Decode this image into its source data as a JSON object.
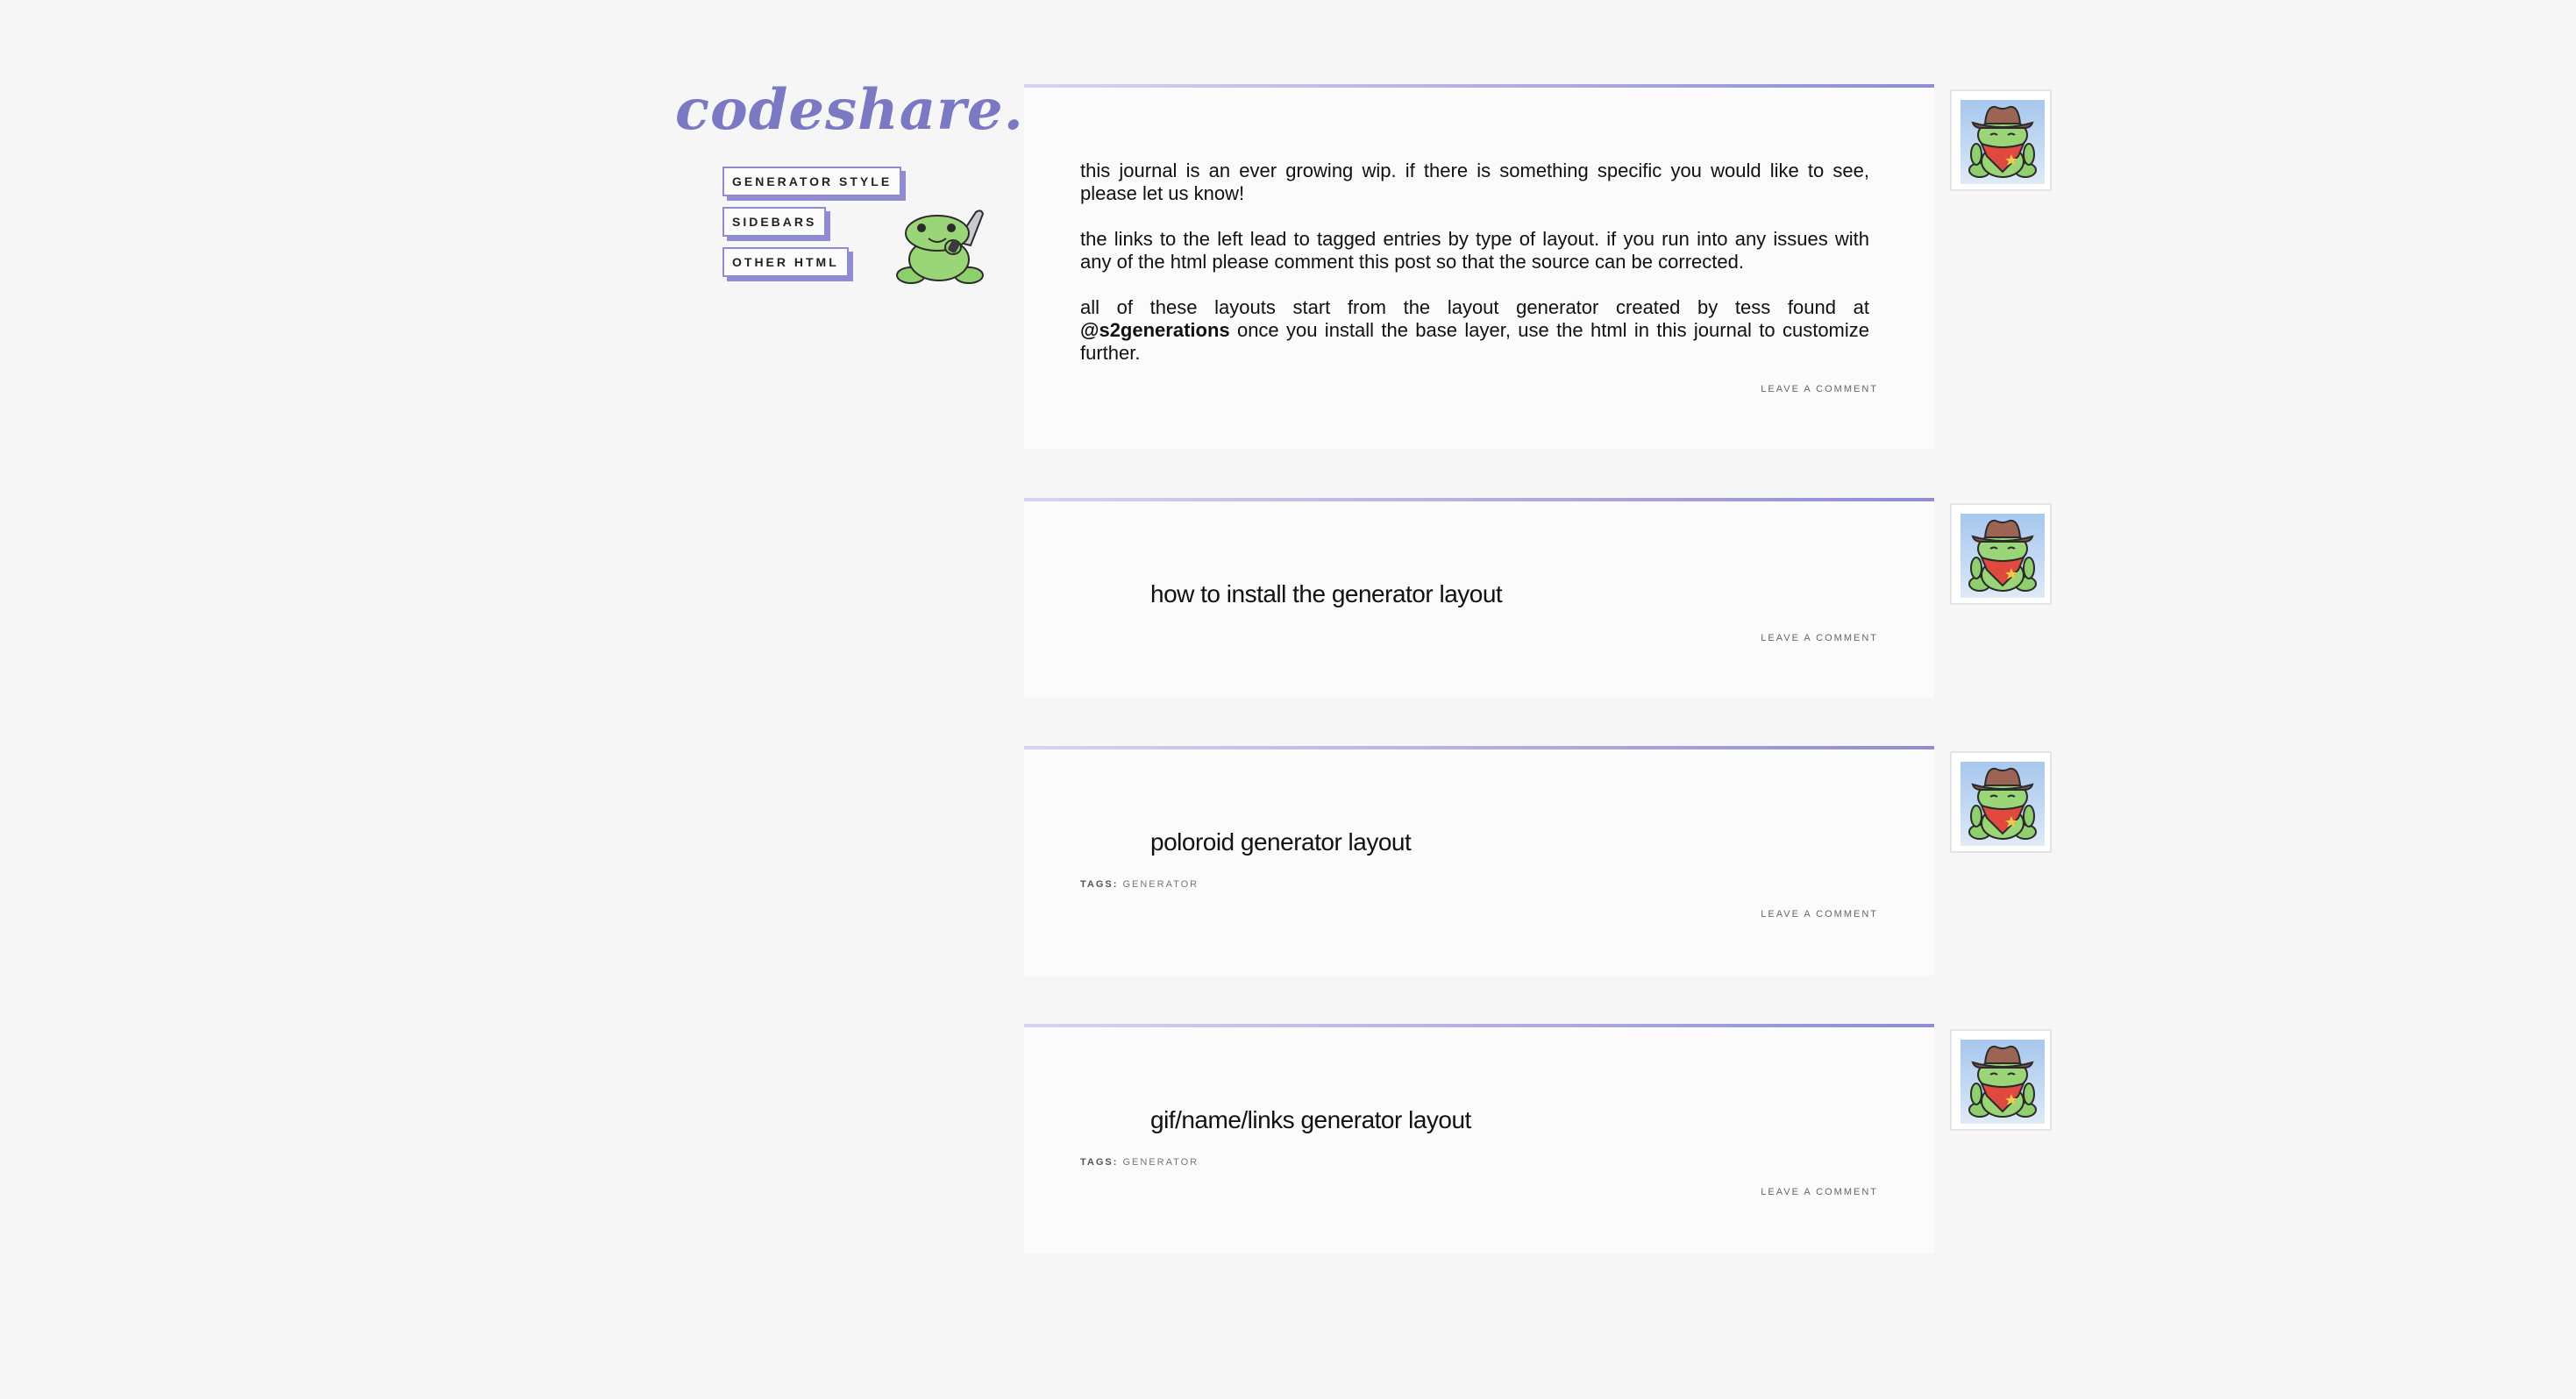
{
  "site": {
    "title": "codeshare."
  },
  "nav": {
    "items": [
      {
        "label": "GENERATOR STYLE"
      },
      {
        "label": "SIDEBARS"
      },
      {
        "label": "OTHER HTML"
      }
    ]
  },
  "entries": [
    {
      "paragraphs": [
        "this journal is an ever growing wip. if there is something specific you would like to see, please let us know!",
        "the links to the left lead to tagged entries by type of layout. if you run into any issues with any of the html please comment this post so that the source can be corrected."
      ],
      "p3_before": "all of these layouts start from the layout generator created by tess found at ",
      "p3_handle": "@s2generations",
      "p3_after": " once you install the base layer, use the html in this journal to customize further.",
      "comment_label": "LEAVE A COMMENT"
    },
    {
      "subject": "how to install the generator layout",
      "comment_label": "LEAVE A COMMENT"
    },
    {
      "subject": "poloroid generator layout",
      "tags_label": "TAGS:",
      "tags_value": "GENERATOR",
      "comment_label": "LEAVE A COMMENT"
    },
    {
      "subject": "gif/name/links generator layout",
      "tags_label": "TAGS:",
      "tags_value": "GENERATOR",
      "comment_label": "LEAVE A COMMENT"
    }
  ],
  "colors": {
    "accent": "#8f8cd4",
    "title": "#7b78c4",
    "background": "#f6f6f6",
    "entry_bg": "#fbfbfc"
  },
  "icons": {
    "userpic": "cowboy-frog-icon",
    "sidebar_art": "frog-with-knife-icon"
  }
}
